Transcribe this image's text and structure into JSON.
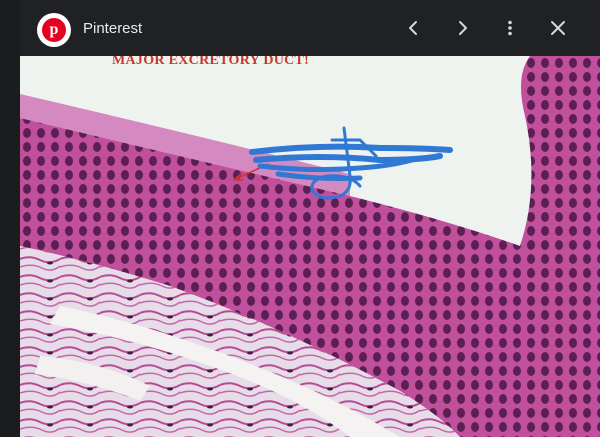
{
  "header": {
    "app_name": "Pinterest",
    "logo_letter": "p"
  },
  "image": {
    "caption": "MAJOR EXCRETORY DUCT!"
  },
  "icons": {
    "back": "chevron-left-icon",
    "forward": "chevron-right-icon",
    "more": "more-vert-icon",
    "close": "close-icon"
  },
  "colors": {
    "toolbar": "#202124",
    "brand": "#e60023",
    "caption": "#c4392a",
    "scribble": "#2f78d3"
  }
}
